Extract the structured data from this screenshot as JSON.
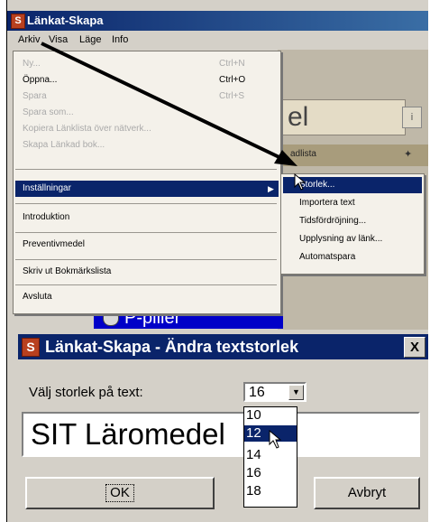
{
  "app": {
    "title": "Länkat-Skapa",
    "menubar": [
      "Arkiv",
      "Visa",
      "Läge",
      "Info"
    ]
  },
  "menu": {
    "items": [
      {
        "label": "Ny...",
        "shortcut": "Ctrl+N",
        "disabled": true
      },
      {
        "label": "Öppna...",
        "shortcut": "Ctrl+O",
        "disabled": false
      },
      {
        "label": "Spara",
        "shortcut": "Ctrl+S",
        "disabled": true
      },
      {
        "label": "Spara som...",
        "shortcut": "",
        "disabled": true
      },
      {
        "label": "Kopiera Länklista över nätverk...",
        "shortcut": "",
        "disabled": true
      },
      {
        "label": "Skapa Länkad bok...",
        "shortcut": "",
        "disabled": true
      }
    ],
    "highlighted": "Inställningar",
    "lower_items": [
      "Introduktion",
      "Preventivmedel",
      "Skriv ut Bokmärkslista",
      "Avsluta"
    ]
  },
  "submenu": {
    "items": [
      "Storlek...",
      "Importera text",
      "Tidsfördröjning...",
      "Upplysning av länk...",
      "Automatspara"
    ]
  },
  "background": {
    "input_text": "el",
    "tab_label": "adlista",
    "list_item": "P-piller"
  },
  "dialog": {
    "title": "Länkat-Skapa - Ändra textstorlek",
    "close_label": "X",
    "size_label": "Välj storlek på text:",
    "selected_size": "16",
    "options": [
      "10",
      "12",
      "14",
      "16",
      "18"
    ],
    "highlighted_option": "12",
    "preview_text": "SIT Läromedel",
    "ok_label": "OK",
    "cancel_label": "Avbryt"
  },
  "colors": {
    "titlebar": "#0a246a",
    "highlight": "#0a246a",
    "list_item_bg": "#0000c8"
  }
}
